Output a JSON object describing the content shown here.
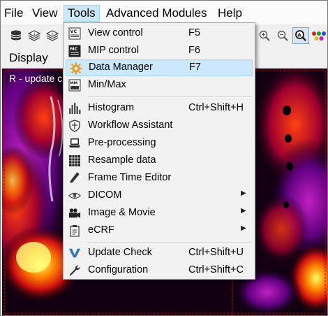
{
  "menubar": {
    "items": [
      {
        "label": "File"
      },
      {
        "label": "View"
      },
      {
        "label": "Tools"
      },
      {
        "label": "Advanced Modules"
      },
      {
        "label": "Help"
      }
    ],
    "active": "Tools"
  },
  "panel": {
    "title": "Display",
    "viewer_label": "R - update c"
  },
  "tools_menu": {
    "items": [
      {
        "label": "View control",
        "shortcut": "F5",
        "icon": "vc-icon"
      },
      {
        "label": "MIP control",
        "shortcut": "F6",
        "icon": "mc-icon"
      },
      {
        "label": "Data Manager",
        "shortcut": "F7",
        "icon": "gear-icon",
        "highlighted": true
      },
      {
        "label": "Min/Max",
        "shortcut": "",
        "icon": "minmax-icon"
      },
      {
        "label": "Histogram",
        "shortcut": "Ctrl+Shift+H",
        "icon": "histogram-icon"
      },
      {
        "label": "Workflow Assistant",
        "shortcut": "",
        "icon": "shield-icon"
      },
      {
        "label": "Pre-processing",
        "shortcut": "",
        "icon": "laptop-icon"
      },
      {
        "label": "Resample data",
        "shortcut": "",
        "icon": "grid-icon"
      },
      {
        "label": "Frame Time Editor",
        "shortcut": "",
        "icon": "pen-icon"
      },
      {
        "label": "DICOM",
        "shortcut": "",
        "icon": "dicom-icon",
        "submenu": true
      },
      {
        "label": "Image & Movie",
        "shortcut": "",
        "icon": "camera-icon",
        "submenu": true
      },
      {
        "label": "eCRF",
        "shortcut": "",
        "icon": "clipboard-icon",
        "submenu": true
      },
      {
        "label": "Update Check",
        "shortcut": "Ctrl+Shift+U",
        "icon": "update-icon"
      },
      {
        "label": "Configuration",
        "shortcut": "Ctrl+Shift+C",
        "icon": "wrench-icon"
      }
    ]
  },
  "colors": {
    "highlight": "#cce8ff",
    "highlight_border": "#99d1ff",
    "menu_bg": "#f2f2f2"
  }
}
